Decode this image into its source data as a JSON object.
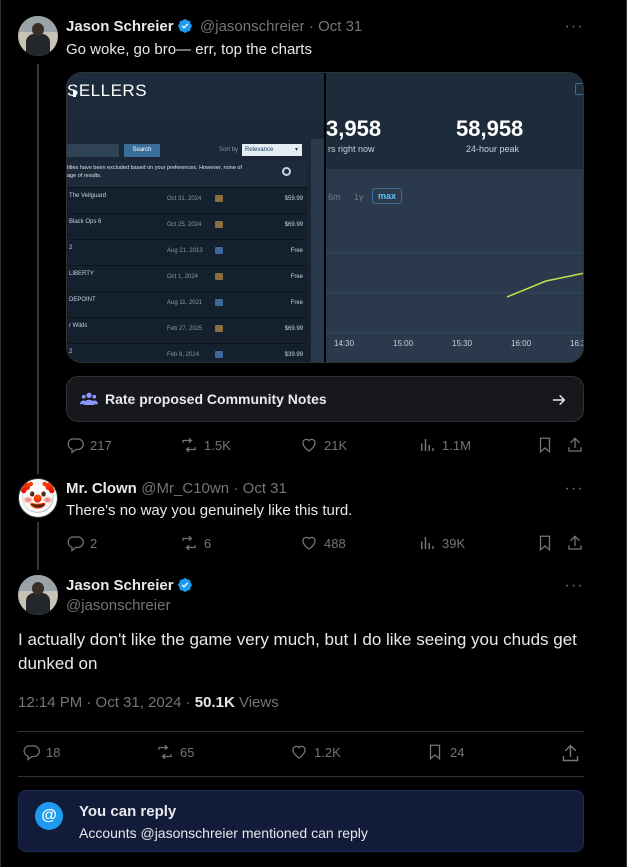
{
  "tweets": [
    {
      "name": "Jason Schreier",
      "handle": "@jasonschreier",
      "date": "· Oct 31",
      "text": "Go woke, go bro— err, top the charts",
      "stats": {
        "replies": "217",
        "reposts": "1.5K",
        "likes": "21K",
        "views": "1.1M"
      }
    },
    {
      "name": "Mr. Clown",
      "handle": "@Mr_C10wn",
      "date": "· Oct 31",
      "text": "There's no way you genuinely like this turd.",
      "stats": {
        "replies": "2",
        "reposts": "6",
        "likes": "488",
        "views": "39K"
      }
    }
  ],
  "main": {
    "name": "Jason Schreier",
    "handle": "@jasonschreier",
    "text": "I actually don't like the game very much, but I do like seeing you chuds get dunked on",
    "timestamp": "12:14 PM · Oct 31, 2024 ·",
    "views_count": "50.1K",
    "views_label": "Views",
    "stats": {
      "replies": "18",
      "reposts": "65",
      "likes": "1.2K",
      "bookmarks": "24"
    }
  },
  "media": {
    "left_title": "SELLERS",
    "search_button": "Search",
    "sort_by_label": "Sort by",
    "sort_value": "Relevance",
    "notice": "titles have been excluded based on your preferences. However, none of\nage of results.",
    "rows": [
      {
        "title": "The Veilguard",
        "date": "Oct 31, 2024",
        "price": "$59.99",
        "icon_color": "#8a6e3c"
      },
      {
        "title": "Black Ops 6",
        "date": "Oct 25, 2024",
        "price": "$69.99",
        "icon_color": "#8a6e3c"
      },
      {
        "title": "2",
        "date": "Aug 21, 2013",
        "price": "Free",
        "icon_color": "#3d6a9a"
      },
      {
        "title": "LIBERTY",
        "date": "Oct 1, 2024",
        "price": "Free",
        "icon_color": "#8a6e3c"
      },
      {
        "title": "DEPOINT",
        "date": "Aug 11, 2021",
        "price": "Free",
        "icon_color": "#3d6a9a"
      },
      {
        "title": "r Wilds",
        "date": "Feb 27, 2025",
        "price": "$69.99",
        "icon_color": "#8a6e3c"
      },
      {
        "title": "2",
        "date": "Feb 8, 2024",
        "price": "$39.99",
        "icon_color": "#3d6a9a"
      }
    ],
    "stat_left_value": "3,958",
    "stat_left_label": "rs right now",
    "stat_right_value": "58,958",
    "stat_right_label": "24-hour peak",
    "range_buttons": [
      "6m",
      "1y",
      "max"
    ],
    "x_ticks": [
      "14:30",
      "15:00",
      "15:30",
      "16:00",
      "16:30"
    ]
  },
  "community_notes": "Rate proposed Community Notes",
  "reply_restriction": {
    "title": "You can reply",
    "subtitle": "Accounts @jasonschreier mentioned can reply"
  }
}
